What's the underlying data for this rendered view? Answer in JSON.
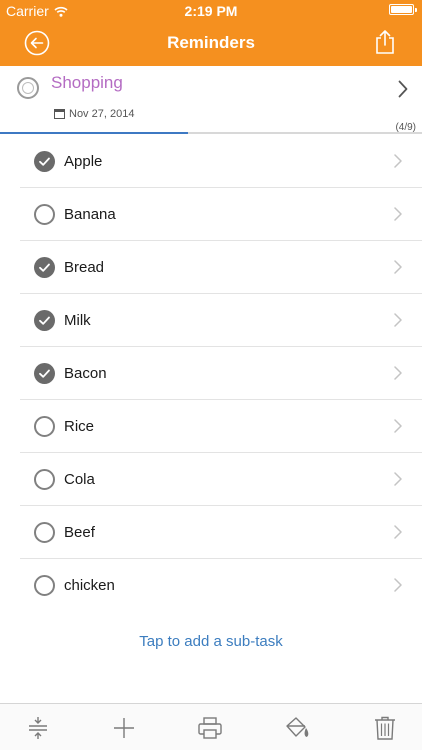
{
  "status_bar": {
    "carrier": "Carrier",
    "time": "2:19 PM",
    "icons": [
      "wifi-icon",
      "battery-icon"
    ]
  },
  "nav": {
    "title": "Reminders",
    "left_icon": "back-arrow-circle-icon",
    "right_icon": "share-icon"
  },
  "task": {
    "title": "Shopping",
    "date": "Nov 27, 2014",
    "progress_label": "(4/9)",
    "completed": 4,
    "total": 9
  },
  "subtasks": [
    {
      "label": "Apple",
      "done": true
    },
    {
      "label": "Banana",
      "done": false
    },
    {
      "label": "Bread",
      "done": true
    },
    {
      "label": "Milk",
      "done": true
    },
    {
      "label": "Bacon",
      "done": true
    },
    {
      "label": "Rice",
      "done": false
    },
    {
      "label": "Cola",
      "done": false
    },
    {
      "label": "Beef",
      "done": false
    },
    {
      "label": "chicken",
      "done": false
    }
  ],
  "add_subtask_label": "Tap to add a sub-task",
  "toolbar": {
    "icons": [
      "expand-collapse-icon",
      "add-icon",
      "print-icon",
      "paint-bucket-icon",
      "trash-icon"
    ]
  },
  "colors": {
    "accent": "#f5901f",
    "task_title": "#b46cc3",
    "link": "#3c7dbf",
    "progress": "#3d79c3"
  }
}
